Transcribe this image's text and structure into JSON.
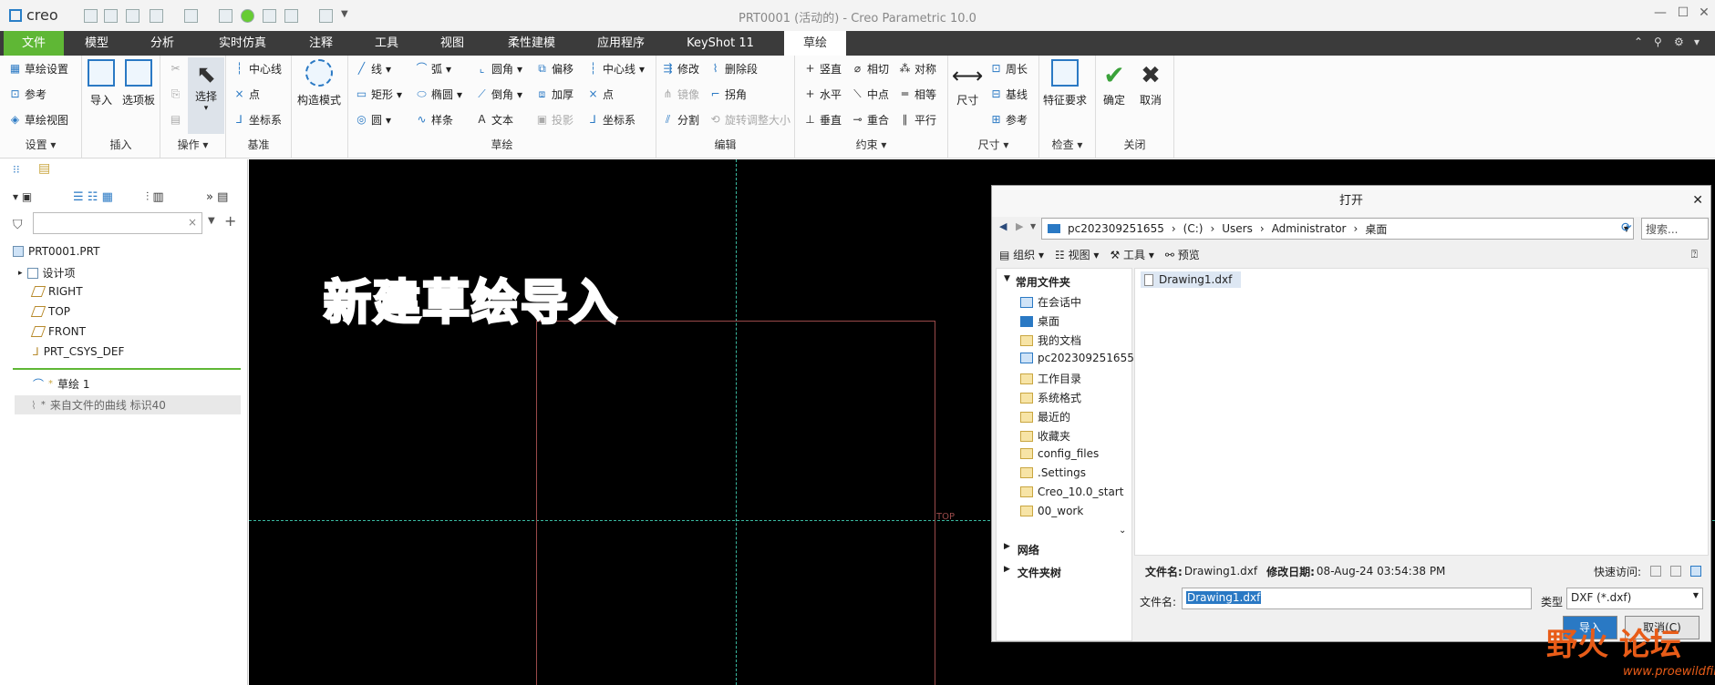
{
  "app": {
    "logo": "creo",
    "title": "PRT0001 (活动的) - Creo Parametric 10.0"
  },
  "menus": [
    "文件",
    "模型",
    "分析",
    "实时仿真",
    "注释",
    "工具",
    "视图",
    "柔性建模",
    "应用程序",
    "KeyShot 11",
    "草绘"
  ],
  "ribbon": {
    "setup": {
      "items": [
        "草绘设置",
        "参考",
        "草绘视图"
      ],
      "label": "设置"
    },
    "insert": {
      "items": [
        "导入",
        "选项板"
      ],
      "label": "插入"
    },
    "ops": {
      "select": "选择",
      "label": "操作"
    },
    "datum": {
      "items": [
        "中心线",
        "点",
        "坐标系"
      ],
      "label": "基准"
    },
    "construct": {
      "label": "构造模式"
    },
    "sketch": {
      "col1": [
        "线",
        "矩形",
        "圆"
      ],
      "col2": [
        "弧",
        "椭圆",
        "样条"
      ],
      "col3": [
        "圆角",
        "倒角",
        "文本"
      ],
      "col4": [
        "偏移",
        "加厚",
        "投影"
      ],
      "col5": [
        "中心线",
        "点",
        "坐标系"
      ],
      "label": "草绘"
    },
    "edit": {
      "items": [
        "修改",
        "镜像",
        "分割",
        "删除段",
        "拐角",
        "旋转调整大小"
      ],
      "label": "编辑"
    },
    "constrain": {
      "col1": [
        "竖直",
        "水平",
        "垂直"
      ],
      "col2": [
        "相切",
        "中点",
        "重合"
      ],
      "col3": [
        "对称",
        "相等",
        "平行"
      ],
      "label": "约束"
    },
    "dim": {
      "big": "尺寸",
      "items": [
        "周长",
        "基线",
        "参考"
      ],
      "label": "尺寸"
    },
    "inspect": {
      "big": "特征要求",
      "label": "检查"
    },
    "close": {
      "ok": "确定",
      "cancel": "取消",
      "label": "关闭"
    }
  },
  "tree": {
    "root": "PRT0001.PRT",
    "items": [
      "设计项",
      "RIGHT",
      "TOP",
      "FRONT",
      "PRT_CSYS_DEF"
    ],
    "sketch": "草绘 1",
    "curve": "来自文件的曲线 标识40"
  },
  "overlay_text": "新建草绘导入",
  "canvas": {
    "top_label": "TOP"
  },
  "dialog": {
    "title": "打开",
    "path": [
      "pc202309251655",
      "(C:)",
      "Users",
      "Administrator",
      "桌面"
    ],
    "search_placeholder": "搜索...",
    "toolbar": [
      "组织",
      "视图",
      "工具",
      "预览"
    ],
    "nav_header": "常用文件夹",
    "nav_items": [
      "在会话中",
      "桌面",
      "我的文档",
      "pc202309251655",
      "工作目录",
      "系统格式",
      "最近的",
      "收藏夹",
      "config_files",
      ".Settings",
      "Creo_10.0_start",
      "00_work"
    ],
    "network": "网络",
    "folder_tree": "文件夹树",
    "file": "Drawing1.dxf",
    "details": {
      "name_label": "文件名:",
      "name": "Drawing1.dxf",
      "date_label": "修改日期:",
      "date": "08-Aug-24 03:54:38 PM",
      "quick": "快速访问:"
    },
    "filename_label": "文件名:",
    "filename": "Drawing1.dxf",
    "type_label": "类型",
    "type": "DXF (*.dxf)",
    "import": "导入",
    "cancel": "取消(C)"
  },
  "watermark": {
    "main": "野火 论坛",
    "sub": "www.proewildfire.cn"
  }
}
